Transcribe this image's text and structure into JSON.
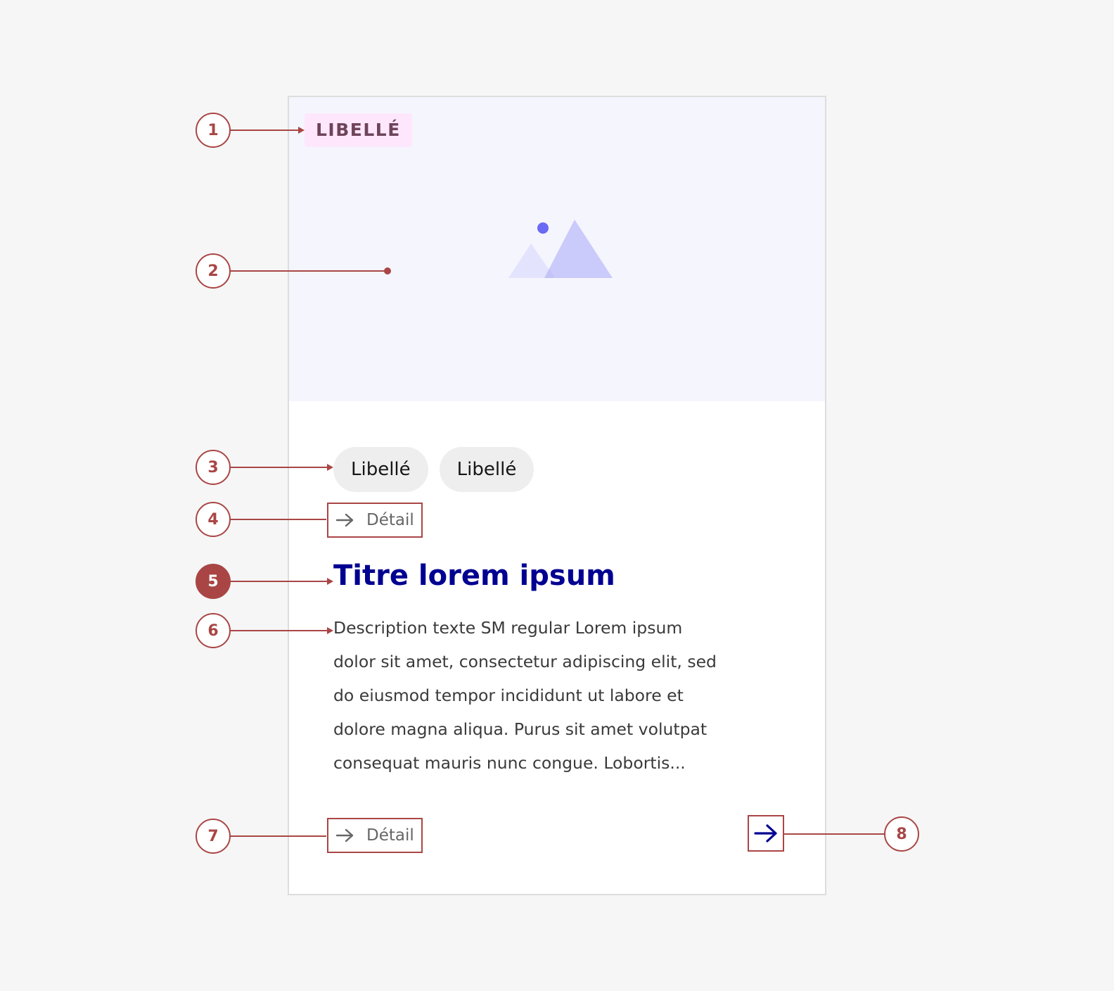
{
  "card": {
    "badge_label": "LIBELLÉ",
    "image_icon": "image-placeholder-icon",
    "tags": [
      "Libellé",
      "Libellé"
    ],
    "detail_top": "Détail",
    "title": "Titre lorem ipsum",
    "description_lines": [
      "Description texte SM regular Lorem ipsum",
      "dolor sit amet, consectetur adipiscing elit, sed",
      "do eiusmod tempor incididunt ut labore et",
      "dolore magna aliqua. Purus sit amet volutpat",
      "consequat mauris nunc congue. Lobortis..."
    ],
    "detail_bottom": "Détail",
    "action_icon": "arrow-right-icon"
  },
  "annotations": [
    "1",
    "2",
    "3",
    "4",
    "5",
    "6",
    "7",
    "8"
  ],
  "colors": {
    "annotation": "#a94645",
    "title": "#000091",
    "badge_bg": "#fee7fc",
    "badge_text": "#6e445a",
    "image_bg": "#f5f5fe",
    "tag_bg": "#eeeeee"
  }
}
